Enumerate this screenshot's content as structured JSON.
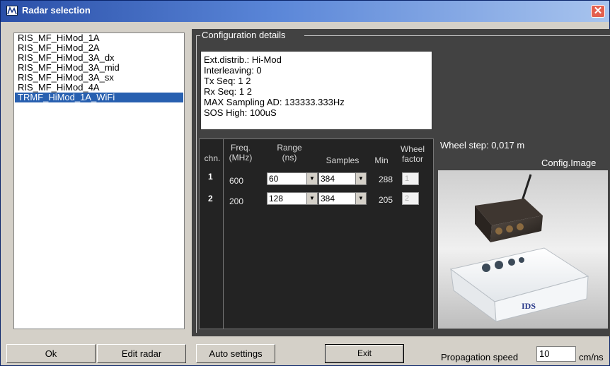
{
  "window": {
    "title": "Radar selection",
    "close_glyph": "✕"
  },
  "radar_list": {
    "items": [
      "RIS_MF_HiMod_1A",
      "RIS_MF_HiMod_2A",
      "RIS_MF_HiMod_3A_dx",
      "RIS_MF_HiMod_3A_mid",
      "RIS_MF_HiMod_3A_sx",
      "RIS_MF_HiMod_4A",
      "TRMF_HiMod_1A_WiFi"
    ],
    "selected": "TRMF_HiMod_1A_WiFi"
  },
  "config": {
    "legend": "Configuration details",
    "lines": [
      "Ext.distrib.: Hi-Mod",
      "Interleaving: 0",
      "Tx Seq: 1 2",
      "Rx Seq: 1 2",
      "MAX Sampling AD: 133333.333Hz",
      "SOS High: 100uS"
    ]
  },
  "table": {
    "headers": {
      "chn": "chn.",
      "freq_1": "Freq.",
      "freq_2": "(MHz)",
      "range_1": "Range",
      "range_2": "(ns)",
      "samples": "Samples",
      "min": "Min",
      "wheel_1": "Wheel",
      "wheel_2": "factor"
    },
    "rows": [
      {
        "chn": "1",
        "freq": "600",
        "range": "60",
        "samples": "384",
        "min": "288",
        "wheel": "1"
      },
      {
        "chn": "2",
        "freq": "200",
        "range": "128",
        "samples": "384",
        "min": "205",
        "wheel": "2"
      }
    ]
  },
  "wheel_step": "Wheel step: 0,017 m",
  "config_image_label": "Config.Image",
  "image_brand_text": "IDS",
  "buttons": {
    "ok": "Ok",
    "edit_radar": "Edit radar",
    "auto_settings": "Auto settings",
    "exit": "Exit"
  },
  "propagation": {
    "label": "Propagation speed",
    "value": "10",
    "unit": "cm/ns"
  },
  "colors": {
    "selection": "#2860b0",
    "panel": "#424242",
    "table_bg": "#232323"
  }
}
